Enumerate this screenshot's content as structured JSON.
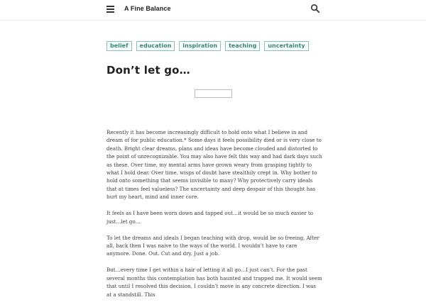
{
  "header": {
    "site_title": "A Fine Balance",
    "menu_icon": "hamburger-icon",
    "search_icon": "search-icon"
  },
  "tags": [
    "belief",
    "education",
    "inspiration",
    "teaching",
    "uncertainty"
  ],
  "post": {
    "title": "Don’t let go…",
    "paragraphs": [
      "Recently it has become increasingly difficult to hold onto what I believe in and dream of for public education.* Some days it feels possibility died or is very close to death.  Bright clear dreams, plans and ideas have become clouded and distorted to the point of unrecognizable. You may also have felt this way and had dark days such as these. Over time, my mental arms have grown weary from grasping tightly to what I hold dear. Over time, wisps of doubt have stealthily crept in. Why bother to hold onto something that seems invisible to many? Why protectively carry ideals that at times feel valueless? The uncertainty and deep despair of this thought has hurt my heart, mind and inner core.",
      "It feels as I have been worn down and tapped out…it would be so much easier to just…let go…",
      "To let the dreams and ideals I began teaching with drop, would be so freeing.  After all, back then I was naive to the ways of the world. I wouldn’t have to care anymore. Done. Out. Cut and dry. Just a job.",
      "But…every time I get within a hair of letting it all go…I just can’t. For the past several months this contemplation has both haunted and trapped me.  It would seem that until I resolved this decision, I couldn’t move in any concrete direction. I was at a standstill. This"
    ]
  },
  "colors": {
    "tag_border": "#84c3b8",
    "tag_text": "#2e8877",
    "title": "#222222",
    "body_text": "#3d3d3d"
  }
}
